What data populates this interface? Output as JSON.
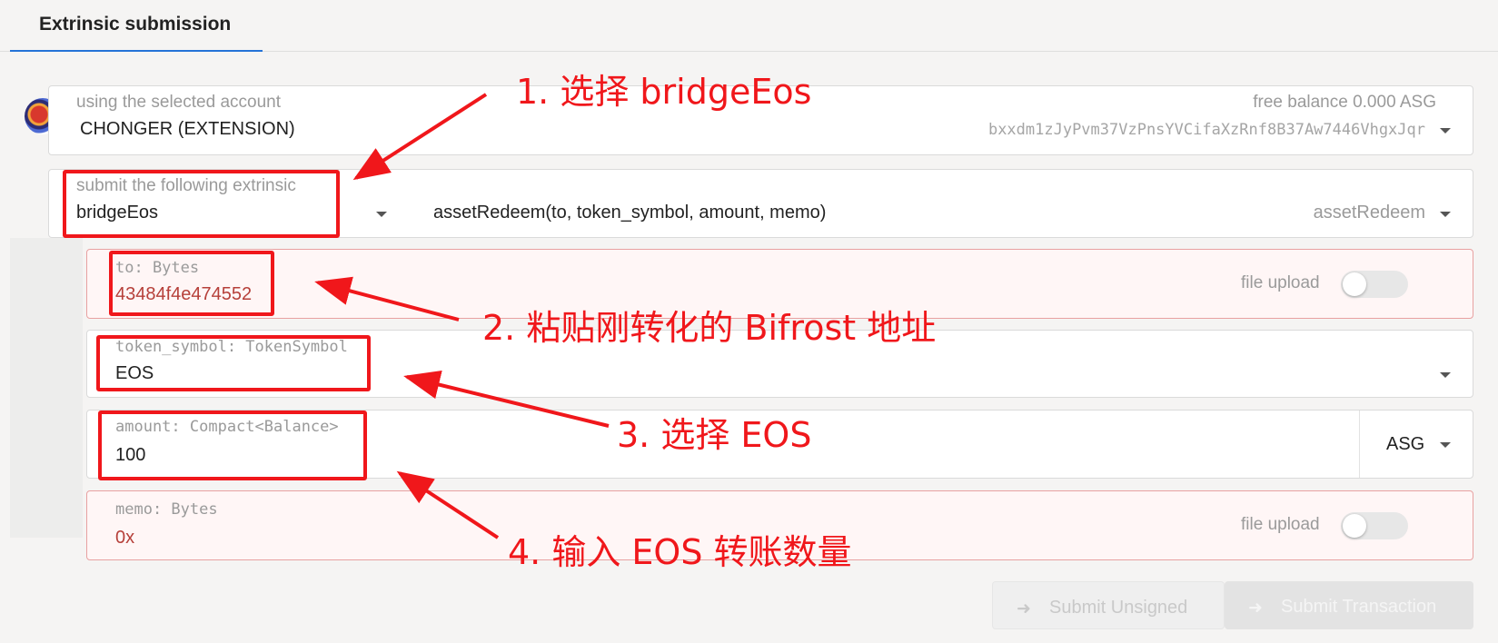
{
  "tab": {
    "label": "Extrinsic submission"
  },
  "account": {
    "label": "using the selected account",
    "name": "CHONGER (EXTENSION)",
    "balance": "free balance 0.000 ASG",
    "address": "bxxdm1zJyPvm37VzPnsYVCifaXzRnf8B37Aw7446VhgxJqr"
  },
  "extrinsic": {
    "label": "submit the following extrinsic",
    "module": "bridgeEos",
    "call_signature": "assetRedeem(to, token_symbol, amount, memo)",
    "call": "assetRedeem"
  },
  "params": {
    "to": {
      "label": "to: Bytes",
      "value": "43484f4e474552",
      "file_upload": "file upload"
    },
    "token_symbol": {
      "label": "token_symbol: TokenSymbol",
      "value": "EOS"
    },
    "amount": {
      "label": "amount: Compact<Balance>",
      "value": "100",
      "unit": "ASG"
    },
    "memo": {
      "label": "memo: Bytes",
      "value": "0x",
      "file_upload": "file upload"
    }
  },
  "buttons": {
    "unsigned": "Submit Unsigned",
    "submit": "Submit Transaction"
  },
  "annotations": {
    "a1": "1. 选择 bridgeEos",
    "a2": "2. 粘贴刚转化的 Bifrost 地址",
    "a3": "3. 选择 EOS",
    "a4": "4. 输入 EOS 转账数量"
  },
  "colors": {
    "annotation": "#f0171b",
    "tab_underline": "#2473d7",
    "error_text": "#b6403a"
  },
  "icons": [
    "account-avatar-icon",
    "chevron-down-icon",
    "toggle-switch",
    "sign-in-icon"
  ]
}
